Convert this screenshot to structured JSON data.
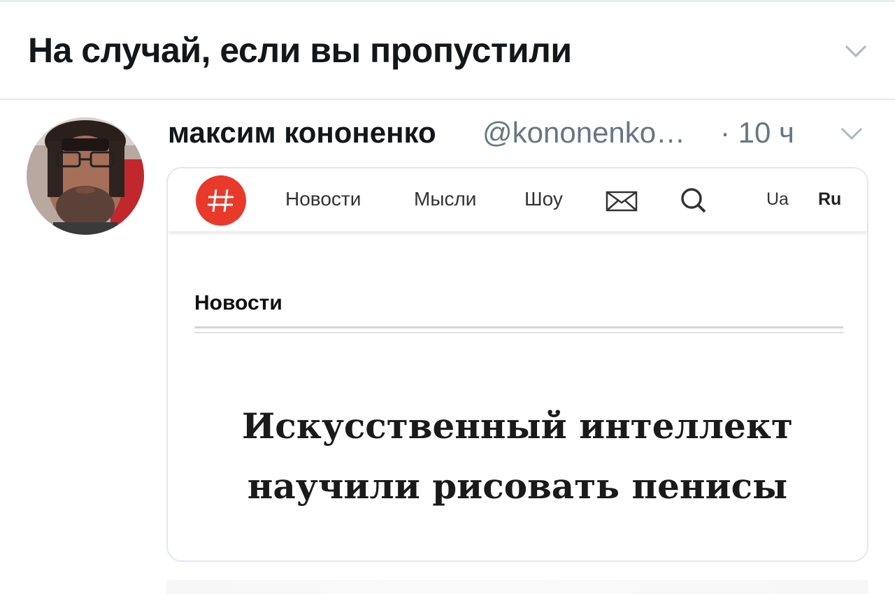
{
  "section": {
    "title": "На случай, если вы пропустили",
    "expand_icon": "chevron-down-icon"
  },
  "tweet": {
    "author_name": "максим кононенко",
    "handle": "@kononenko…",
    "timestamp": "· 10 ч",
    "menu_icon": "chevron-down-icon",
    "avatar": "avatar"
  },
  "card": {
    "logo_icon": "hash-logo-icon",
    "nav": [
      "Новости",
      "Мысли",
      "Шоу"
    ],
    "mail_icon": "mail-icon",
    "search_icon": "search-icon",
    "languages": [
      "Ua",
      "Ru"
    ],
    "active_language": "Ru",
    "logo_color": "#e8392b",
    "section_label": "Новости",
    "headline_line1": "Искусственный интеллект",
    "headline_line2": "научили рисовать пенисы"
  },
  "colors": {
    "text_primary": "#14171a",
    "text_secondary": "#657786",
    "border": "#e1e8ed"
  }
}
